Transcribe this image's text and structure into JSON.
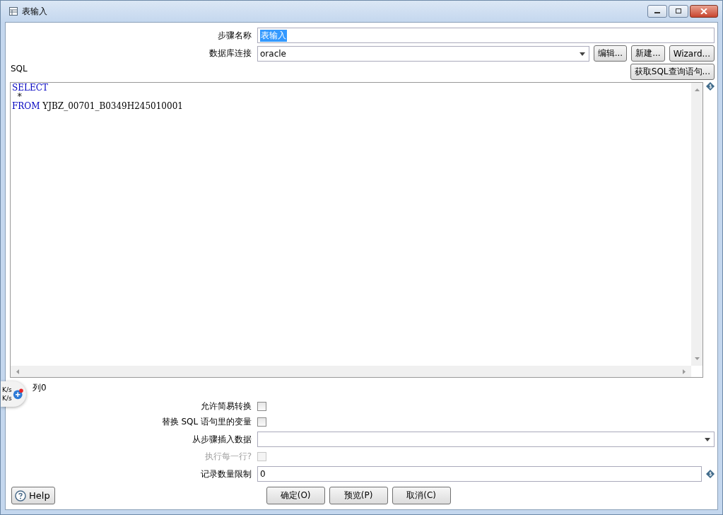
{
  "window": {
    "title": "表输入"
  },
  "step_name": {
    "label": "步骤名称",
    "value": "表输入"
  },
  "connection": {
    "label": "数据库连接",
    "value": "oracle",
    "buttons": [
      "编辑...",
      "新建...",
      "Wizard..."
    ]
  },
  "sql": {
    "label": "SQL",
    "get_button": "获取SQL查询语句...",
    "lines": [
      [
        {
          "kind": "keyword",
          "text": "SELECT"
        }
      ],
      [
        {
          "kind": "plain",
          "text": "  *"
        }
      ],
      [
        {
          "kind": "keyword",
          "text": "FROM"
        },
        {
          "kind": "plain",
          "text": " YJBZ_00701_B0349H245010001"
        }
      ]
    ]
  },
  "position": "列0",
  "speed_widget": {
    "lines": [
      "K/s",
      "K/s"
    ]
  },
  "options": [
    {
      "kind": "checkbox",
      "label": "允许简易转换",
      "checked": false,
      "disabled": false
    },
    {
      "kind": "checkbox",
      "label": "替换 SQL 语句里的变量",
      "checked": false,
      "disabled": false
    },
    {
      "kind": "dropdown",
      "label": "从步骤插入数据"
    },
    {
      "kind": "checkbox",
      "label": "执行每一行?",
      "checked": false,
      "disabled": true
    },
    {
      "kind": "text",
      "label": "记录数量限制",
      "value": "0"
    }
  ],
  "help_button": "Help",
  "buttons": [
    "确定(O)",
    "预览(P)",
    "取消(C)"
  ]
}
